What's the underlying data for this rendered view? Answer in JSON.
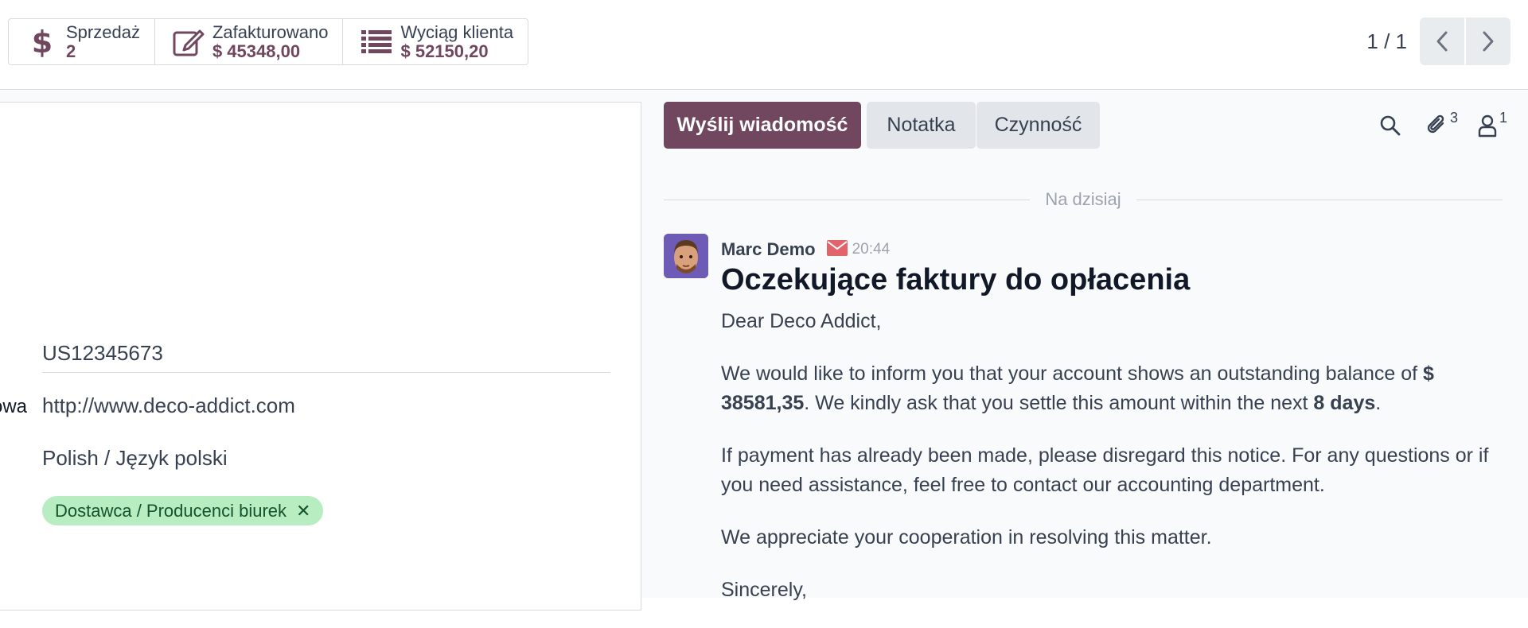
{
  "smart_buttons": [
    {
      "label": "Sprzedaż",
      "value": "2",
      "icon": "dollar-icon"
    },
    {
      "label": "Zafakturowano",
      "value": "$ 45348,00",
      "icon": "edit-icon"
    },
    {
      "label": "Wyciąg klienta",
      "value": "$ 52150,20",
      "icon": "list-icon"
    }
  ],
  "pager": {
    "value": "1 / 1"
  },
  "form": {
    "vat": "US12345673",
    "website_label_fragment": "owa",
    "website": "http://www.deco-addict.com",
    "language": "Polish / Język polski",
    "tag": "Dostawca / Producenci biurek",
    "tag_remove": "✕"
  },
  "chatter": {
    "send_message": "Wyślij wiadomość",
    "note": "Notatka",
    "activity": "Czynność",
    "attachments_count": "3",
    "followers_count": "1",
    "date_separator": "Na dzisiaj",
    "message": {
      "author": "Marc Demo",
      "time": "20:44",
      "subject": "Oczekujące faktury do opłacenia",
      "greeting": "Dear Deco Addict,",
      "p1_start": "We would like to inform you that your account shows an outstanding balance of ",
      "amount": "$ 38581,35",
      "p1_mid": ". We kindly ask that you settle this amount within the next ",
      "days": "8 days",
      "p1_end": ".",
      "p2": "If payment has already been made, please disregard this notice. For any questions or if you need assistance, feel free to contact our accounting department.",
      "p3": "We appreciate your cooperation in resolving this matter.",
      "closing": "Sincerely,"
    }
  },
  "colors": {
    "accent": "#71475f",
    "tag_bg": "#b8ecc1",
    "envelope": "#e0646a"
  }
}
